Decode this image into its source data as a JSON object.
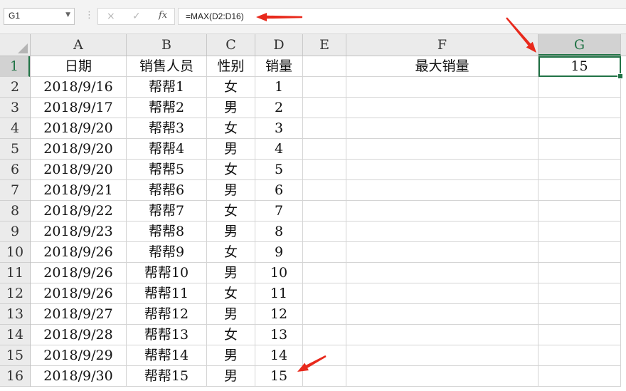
{
  "formula_bar": {
    "name_box": "G1",
    "cancel_icon": "×",
    "enter_icon": "✓",
    "fx_label": "fx",
    "formula": "=MAX(D2:D16)"
  },
  "grid": {
    "columns": [
      "A",
      "B",
      "C",
      "D",
      "E",
      "F",
      "G"
    ],
    "rows": [
      "1",
      "2",
      "3",
      "4",
      "5",
      "6",
      "7",
      "8",
      "9",
      "10",
      "11",
      "12",
      "13",
      "14",
      "15",
      "16"
    ],
    "selected_cell": "G1",
    "accent_color": "#217346",
    "data": [
      [
        "日期",
        "销售人员",
        "性别",
        "销量",
        "",
        "最大销量",
        "15"
      ],
      [
        "2018/9/16",
        "帮帮1",
        "女",
        "1",
        "",
        "",
        ""
      ],
      [
        "2018/9/17",
        "帮帮2",
        "男",
        "2",
        "",
        "",
        ""
      ],
      [
        "2018/9/20",
        "帮帮3",
        "女",
        "3",
        "",
        "",
        ""
      ],
      [
        "2018/9/20",
        "帮帮4",
        "男",
        "4",
        "",
        "",
        ""
      ],
      [
        "2018/9/20",
        "帮帮5",
        "女",
        "5",
        "",
        "",
        ""
      ],
      [
        "2018/9/21",
        "帮帮6",
        "男",
        "6",
        "",
        "",
        ""
      ],
      [
        "2018/9/22",
        "帮帮7",
        "女",
        "7",
        "",
        "",
        ""
      ],
      [
        "2018/9/23",
        "帮帮8",
        "男",
        "8",
        "",
        "",
        ""
      ],
      [
        "2018/9/26",
        "帮帮9",
        "女",
        "9",
        "",
        "",
        ""
      ],
      [
        "2018/9/26",
        "帮帮10",
        "男",
        "10",
        "",
        "",
        ""
      ],
      [
        "2018/9/26",
        "帮帮11",
        "女",
        "11",
        "",
        "",
        ""
      ],
      [
        "2018/9/27",
        "帮帮12",
        "男",
        "12",
        "",
        "",
        ""
      ],
      [
        "2018/9/28",
        "帮帮13",
        "女",
        "13",
        "",
        "",
        ""
      ],
      [
        "2018/9/29",
        "帮帮14",
        "男",
        "14",
        "",
        "",
        ""
      ],
      [
        "2018/9/30",
        "帮帮15",
        "男",
        "15",
        "",
        "",
        ""
      ]
    ]
  },
  "annotations": {
    "arrow_color": "#e8291c",
    "arrow_targets": [
      "formula",
      "G1",
      "D16"
    ]
  }
}
